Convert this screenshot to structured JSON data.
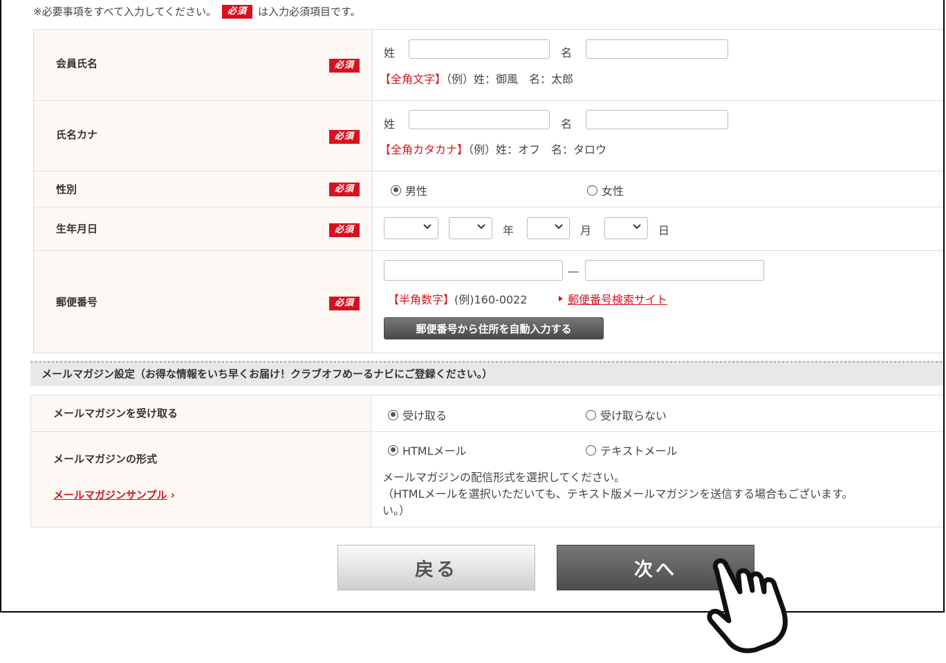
{
  "notice": {
    "prefix": "※必要事項をすべて入力してください。",
    "badge": "必須",
    "suffix": "は入力必須項目です。"
  },
  "required_badge": "必須",
  "rows": {
    "name": {
      "label": "会員氏名",
      "sei_label": "姓",
      "mei_label": "名",
      "hint_red": "【全角文字】",
      "hint": "（例）姓：御風　名：太郎"
    },
    "kana": {
      "label": "氏名カナ",
      "sei_label": "姓",
      "mei_label": "名",
      "hint_red": "【全角カタカナ】",
      "hint": "（例）姓：オフ　名：タロウ"
    },
    "gender": {
      "label": "性別",
      "options": [
        "男性",
        "女性"
      ],
      "selected": "男性"
    },
    "birthday": {
      "label": "生年月日",
      "year_unit": "年",
      "month_unit": "月",
      "day_unit": "日"
    },
    "zip": {
      "label": "郵便番号",
      "dash": "—",
      "hint_red": "【半角数字】",
      "hint": "(例)160-0022",
      "search_link": "郵便番号検索サイト",
      "autofill_button": "郵便番号から住所を自動入力する"
    }
  },
  "mailmag": {
    "section_title": "メールマガジン設定（お得な情報をいち早くお届け！クラブオフめーるナビにご登録ください。）",
    "receive": {
      "label": "メールマガジンを受け取る",
      "options": [
        "受け取る",
        "受け取らない"
      ],
      "selected": "受け取る"
    },
    "format": {
      "label": "メールマガジンの形式",
      "sample_link": "メールマガジンサンプル",
      "sample_arrow": "›",
      "options": [
        "HTMLメール",
        "テキストメール"
      ],
      "selected": "HTMLメール",
      "desc1": "メールマガジンの配信形式を選択してください。",
      "desc2": "（HTMLメールを選択いただいても、テキスト版メールマガジンを送信する場合もございます。",
      "desc3": "い。）"
    }
  },
  "buttons": {
    "back": "戻る",
    "next": "次へ"
  },
  "colors": {
    "required_red": "#d7121f",
    "label_bg": "#fdf8f4",
    "section_bg": "#e8e8e8",
    "next_button": "#555555"
  },
  "icons": [
    "chevron-down-icon",
    "triangle-right-icon",
    "pointing-hand-icon"
  ]
}
